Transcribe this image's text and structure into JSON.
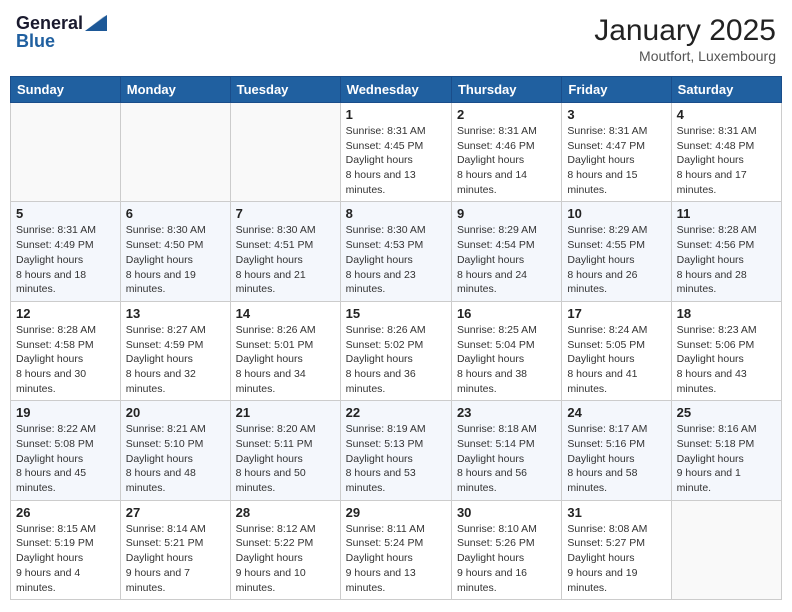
{
  "header": {
    "logo_general": "General",
    "logo_blue": "Blue",
    "month_title": "January 2025",
    "location": "Moutfort, Luxembourg"
  },
  "weekdays": [
    "Sunday",
    "Monday",
    "Tuesday",
    "Wednesday",
    "Thursday",
    "Friday",
    "Saturday"
  ],
  "weeks": [
    [
      {
        "day": "",
        "sunrise": "",
        "sunset": "",
        "daylight": ""
      },
      {
        "day": "",
        "sunrise": "",
        "sunset": "",
        "daylight": ""
      },
      {
        "day": "",
        "sunrise": "",
        "sunset": "",
        "daylight": ""
      },
      {
        "day": "1",
        "sunrise": "Sunrise: 8:31 AM",
        "sunset": "Sunset: 4:45 PM",
        "daylight": "Daylight: 8 hours and 13 minutes."
      },
      {
        "day": "2",
        "sunrise": "Sunrise: 8:31 AM",
        "sunset": "Sunset: 4:46 PM",
        "daylight": "Daylight: 8 hours and 14 minutes."
      },
      {
        "day": "3",
        "sunrise": "Sunrise: 8:31 AM",
        "sunset": "Sunset: 4:47 PM",
        "daylight": "Daylight: 8 hours and 15 minutes."
      },
      {
        "day": "4",
        "sunrise": "Sunrise: 8:31 AM",
        "sunset": "Sunset: 4:48 PM",
        "daylight": "Daylight: 8 hours and 17 minutes."
      }
    ],
    [
      {
        "day": "5",
        "sunrise": "Sunrise: 8:31 AM",
        "sunset": "Sunset: 4:49 PM",
        "daylight": "Daylight: 8 hours and 18 minutes."
      },
      {
        "day": "6",
        "sunrise": "Sunrise: 8:30 AM",
        "sunset": "Sunset: 4:50 PM",
        "daylight": "Daylight: 8 hours and 19 minutes."
      },
      {
        "day": "7",
        "sunrise": "Sunrise: 8:30 AM",
        "sunset": "Sunset: 4:51 PM",
        "daylight": "Daylight: 8 hours and 21 minutes."
      },
      {
        "day": "8",
        "sunrise": "Sunrise: 8:30 AM",
        "sunset": "Sunset: 4:53 PM",
        "daylight": "Daylight: 8 hours and 23 minutes."
      },
      {
        "day": "9",
        "sunrise": "Sunrise: 8:29 AM",
        "sunset": "Sunset: 4:54 PM",
        "daylight": "Daylight: 8 hours and 24 minutes."
      },
      {
        "day": "10",
        "sunrise": "Sunrise: 8:29 AM",
        "sunset": "Sunset: 4:55 PM",
        "daylight": "Daylight: 8 hours and 26 minutes."
      },
      {
        "day": "11",
        "sunrise": "Sunrise: 8:28 AM",
        "sunset": "Sunset: 4:56 PM",
        "daylight": "Daylight: 8 hours and 28 minutes."
      }
    ],
    [
      {
        "day": "12",
        "sunrise": "Sunrise: 8:28 AM",
        "sunset": "Sunset: 4:58 PM",
        "daylight": "Daylight: 8 hours and 30 minutes."
      },
      {
        "day": "13",
        "sunrise": "Sunrise: 8:27 AM",
        "sunset": "Sunset: 4:59 PM",
        "daylight": "Daylight: 8 hours and 32 minutes."
      },
      {
        "day": "14",
        "sunrise": "Sunrise: 8:26 AM",
        "sunset": "Sunset: 5:01 PM",
        "daylight": "Daylight: 8 hours and 34 minutes."
      },
      {
        "day": "15",
        "sunrise": "Sunrise: 8:26 AM",
        "sunset": "Sunset: 5:02 PM",
        "daylight": "Daylight: 8 hours and 36 minutes."
      },
      {
        "day": "16",
        "sunrise": "Sunrise: 8:25 AM",
        "sunset": "Sunset: 5:04 PM",
        "daylight": "Daylight: 8 hours and 38 minutes."
      },
      {
        "day": "17",
        "sunrise": "Sunrise: 8:24 AM",
        "sunset": "Sunset: 5:05 PM",
        "daylight": "Daylight: 8 hours and 41 minutes."
      },
      {
        "day": "18",
        "sunrise": "Sunrise: 8:23 AM",
        "sunset": "Sunset: 5:06 PM",
        "daylight": "Daylight: 8 hours and 43 minutes."
      }
    ],
    [
      {
        "day": "19",
        "sunrise": "Sunrise: 8:22 AM",
        "sunset": "Sunset: 5:08 PM",
        "daylight": "Daylight: 8 hours and 45 minutes."
      },
      {
        "day": "20",
        "sunrise": "Sunrise: 8:21 AM",
        "sunset": "Sunset: 5:10 PM",
        "daylight": "Daylight: 8 hours and 48 minutes."
      },
      {
        "day": "21",
        "sunrise": "Sunrise: 8:20 AM",
        "sunset": "Sunset: 5:11 PM",
        "daylight": "Daylight: 8 hours and 50 minutes."
      },
      {
        "day": "22",
        "sunrise": "Sunrise: 8:19 AM",
        "sunset": "Sunset: 5:13 PM",
        "daylight": "Daylight: 8 hours and 53 minutes."
      },
      {
        "day": "23",
        "sunrise": "Sunrise: 8:18 AM",
        "sunset": "Sunset: 5:14 PM",
        "daylight": "Daylight: 8 hours and 56 minutes."
      },
      {
        "day": "24",
        "sunrise": "Sunrise: 8:17 AM",
        "sunset": "Sunset: 5:16 PM",
        "daylight": "Daylight: 8 hours and 58 minutes."
      },
      {
        "day": "25",
        "sunrise": "Sunrise: 8:16 AM",
        "sunset": "Sunset: 5:18 PM",
        "daylight": "Daylight: 9 hours and 1 minute."
      }
    ],
    [
      {
        "day": "26",
        "sunrise": "Sunrise: 8:15 AM",
        "sunset": "Sunset: 5:19 PM",
        "daylight": "Daylight: 9 hours and 4 minutes."
      },
      {
        "day": "27",
        "sunrise": "Sunrise: 8:14 AM",
        "sunset": "Sunset: 5:21 PM",
        "daylight": "Daylight: 9 hours and 7 minutes."
      },
      {
        "day": "28",
        "sunrise": "Sunrise: 8:12 AM",
        "sunset": "Sunset: 5:22 PM",
        "daylight": "Daylight: 9 hours and 10 minutes."
      },
      {
        "day": "29",
        "sunrise": "Sunrise: 8:11 AM",
        "sunset": "Sunset: 5:24 PM",
        "daylight": "Daylight: 9 hours and 13 minutes."
      },
      {
        "day": "30",
        "sunrise": "Sunrise: 8:10 AM",
        "sunset": "Sunset: 5:26 PM",
        "daylight": "Daylight: 9 hours and 16 minutes."
      },
      {
        "day": "31",
        "sunrise": "Sunrise: 8:08 AM",
        "sunset": "Sunset: 5:27 PM",
        "daylight": "Daylight: 9 hours and 19 minutes."
      },
      {
        "day": "",
        "sunrise": "",
        "sunset": "",
        "daylight": ""
      }
    ]
  ]
}
